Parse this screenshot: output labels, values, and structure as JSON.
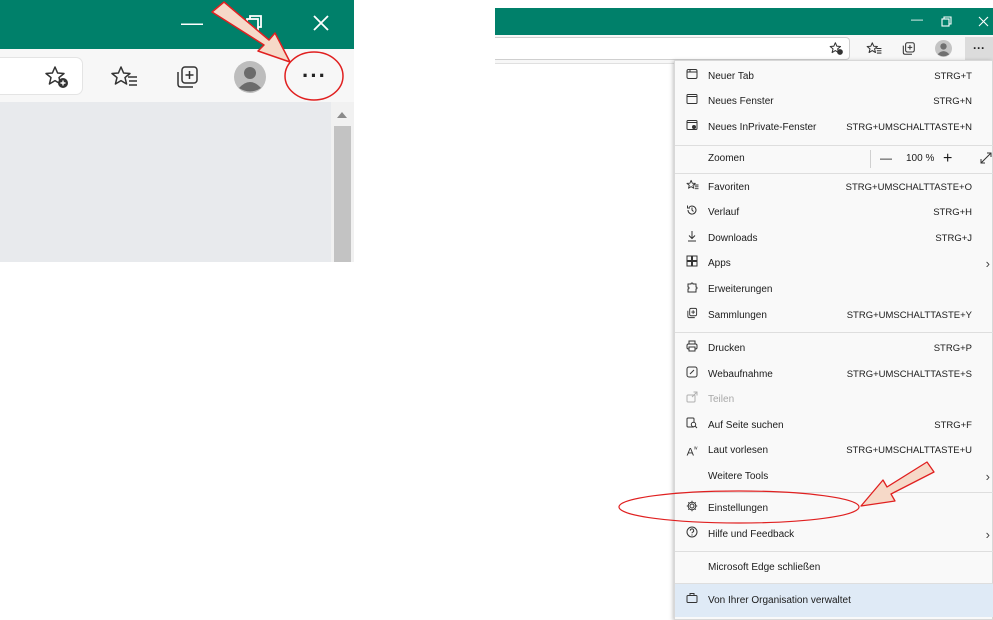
{
  "left": {
    "window_controls": [
      "minimize-icon",
      "restore-icon",
      "close-icon"
    ],
    "toolbar_icons": [
      "add-favorite-icon",
      "favorites-icon",
      "collections-icon",
      "profile-avatar",
      "more-options-icon"
    ],
    "more_label": "···"
  },
  "right": {
    "more_label": "···"
  },
  "menu": {
    "items": [
      {
        "icon": "new-tab-icon",
        "label": "Neuer Tab",
        "shortcut": "STRG+T"
      },
      {
        "icon": "new-window-icon",
        "label": "Neues Fenster",
        "shortcut": "STRG+N"
      },
      {
        "icon": "inprivate-window-icon",
        "label": "Neues InPrivate-Fenster",
        "shortcut": "STRG+UMSCHALTTASTE+N"
      },
      {
        "icon": "",
        "label": "Zoomen",
        "zoom_minus": "—",
        "zoom_value": "100 %",
        "zoom_plus": "+"
      },
      {
        "icon": "favorites-icon",
        "label": "Favoriten",
        "shortcut": "STRG+UMSCHALTTASTE+O"
      },
      {
        "icon": "history-icon",
        "label": "Verlauf",
        "shortcut": "STRG+H"
      },
      {
        "icon": "downloads-icon",
        "label": "Downloads",
        "shortcut": "STRG+J"
      },
      {
        "icon": "apps-icon",
        "label": "Apps",
        "shortcut": ""
      },
      {
        "icon": "extensions-icon",
        "label": "Erweiterungen",
        "shortcut": ""
      },
      {
        "icon": "collections-icon",
        "label": "Sammlungen",
        "shortcut": "STRG+UMSCHALTTASTE+Y"
      },
      {
        "icon": "print-icon",
        "label": "Drucken",
        "shortcut": "STRG+P"
      },
      {
        "icon": "web-capture-icon",
        "label": "Webaufnahme",
        "shortcut": "STRG+UMSCHALTTASTE+S"
      },
      {
        "icon": "share-icon",
        "label": "Teilen",
        "shortcut": ""
      },
      {
        "icon": "find-on-page-icon",
        "label": "Auf Seite suchen",
        "shortcut": "STRG+F"
      },
      {
        "icon": "read-aloud-icon",
        "label": "Laut vorlesen",
        "shortcut": "STRG+UMSCHALTTASTE+U"
      },
      {
        "icon": "",
        "label": "Weitere Tools",
        "shortcut": ""
      },
      {
        "icon": "settings-icon",
        "label": "Einstellungen",
        "shortcut": ""
      },
      {
        "icon": "help-icon",
        "label": "Hilfe und Feedback",
        "shortcut": ""
      },
      {
        "icon": "",
        "label": "Microsoft Edge schließen",
        "shortcut": ""
      },
      {
        "icon": "briefcase-icon",
        "label": "Von Ihrer Organisation verwaltet",
        "shortcut": ""
      }
    ]
  },
  "colors": {
    "titlebar": "#00806a",
    "annotation_red": "#e02020",
    "arrow_fill": "#f6d9c8"
  }
}
